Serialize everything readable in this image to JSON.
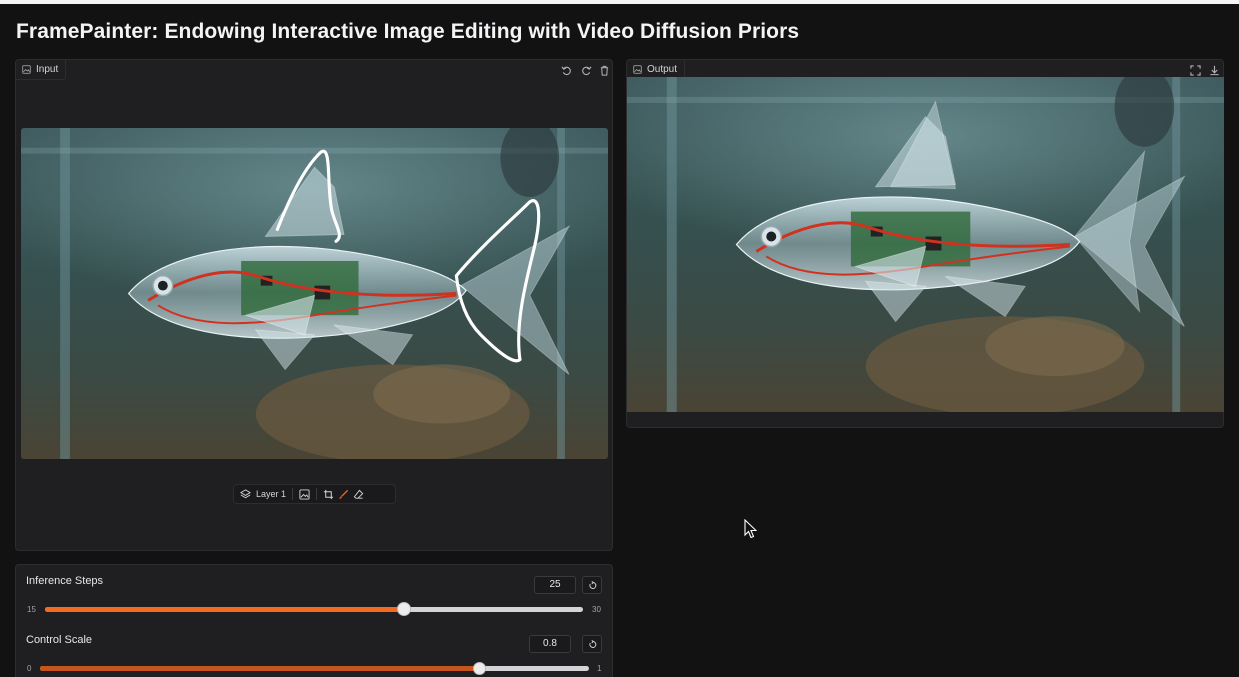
{
  "title": "FramePainter: Endowing Interactive Image Editing with Video Diffusion Priors",
  "input_panel": {
    "label": "Input",
    "toolbar": {
      "layer_label": "Layer 1"
    }
  },
  "output_panel": {
    "label": "Output"
  },
  "sliders": [
    {
      "label": "Inference Steps",
      "value": "25",
      "min": "15",
      "max": "30",
      "fraction": 0.667
    },
    {
      "label": "Control Scale",
      "value": "0.8",
      "min": "0",
      "max": "1",
      "fraction": 0.8
    }
  ],
  "colors": {
    "accent": "#f26b21",
    "background": "#121213",
    "panel": "#1f1f21"
  }
}
